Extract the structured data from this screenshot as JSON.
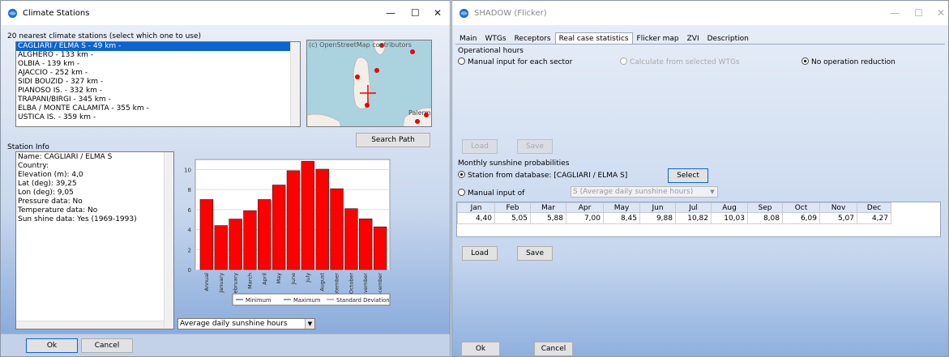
{
  "climate": {
    "title": "Climate Stations",
    "stations_header": "20 nearest climate stations (select which one to use)",
    "stations": [
      "CAGLIARI / ELMA S - 49 km -",
      "ALGHERO - 133 km -",
      "OLBIA - 139 km -",
      "AJACCIO - 252 km -",
      "SIDI BOUZID - 327 km -",
      "PIANOSO IS. - 332 km -",
      "TRAPANI/BIRGI - 345 km -",
      "ELBA / MONTE CALAMITA - 355 km -",
      "USTICA IS. - 359 km -"
    ],
    "map_attribution": "(c) OpenStreetMap contributors",
    "map_label": "Palerm",
    "search_path_label": "Search Path",
    "station_info_label": "Station Info",
    "info_lines": [
      "Name: CAGLIARI / ELMA S",
      "Country:",
      "Elevation (m): 4,0",
      "Lat (deg): 39,25",
      "Lon (deg): 9,05",
      "Pressure data: No",
      "Temperature data: No",
      "Sun shine data: Yes (1969-1993)"
    ],
    "chart_select_value": "Average daily sunshine hours",
    "ok_label": "Ok",
    "cancel_label": "Cancel"
  },
  "chart_data": {
    "type": "bar",
    "categories": [
      "Annual",
      "January",
      "February",
      "March",
      "April",
      "May",
      "June",
      "July",
      "August",
      "September",
      "October",
      "November",
      "December"
    ],
    "values": [
      7.0,
      4.4,
      5.05,
      5.88,
      7.0,
      8.45,
      9.88,
      10.82,
      10.03,
      8.08,
      6.09,
      5.07,
      4.27
    ],
    "ylim": [
      0,
      11
    ],
    "yticks": [
      "0",
      "2",
      "4",
      "6",
      "8",
      "10"
    ],
    "legend": [
      "Minimum",
      "Maximum",
      "Standard Deviation"
    ],
    "legend_colors": [
      "#1e5fc9",
      "#1a8a2a",
      "#909090"
    ],
    "bar_color": "#ff0000",
    "grid": true
  },
  "shadow": {
    "title": "SHADOW (Flicker)",
    "tabs": [
      "Main",
      "WTGs",
      "Receptors",
      "Real case statistics",
      "Flicker map",
      "ZVI",
      "Description"
    ],
    "active_tab": "Real case statistics",
    "operational_hours_label": "Operational hours",
    "op_options": [
      "Manual input for each sector",
      "Calculate from selected WTGs",
      "No operation reduction"
    ],
    "load_label": "Load",
    "save_label": "Save",
    "monthly_label": "Monthly sunshine probabilities",
    "station_option": "Station from database: [CAGLIARI / ELMA S]",
    "select_label": "Select",
    "manual_option": "Manual input of",
    "manual_combo_value": "S (Average daily sunshine hours)",
    "months": [
      "Jan",
      "Feb",
      "Mar",
      "Apr",
      "May",
      "Jun",
      "Jul",
      "Aug",
      "Sep",
      "Oct",
      "Nov",
      "Dec"
    ],
    "month_values": [
      "4,40",
      "5,05",
      "5,88",
      "7,00",
      "8,45",
      "9,88",
      "10,82",
      "10,03",
      "8,08",
      "6,09",
      "5,07",
      "4,27"
    ],
    "load2_label": "Load",
    "save2_label": "Save",
    "ok_label": "Ok",
    "cancel_label": "Cancel"
  },
  "colors": {
    "accent": "#0a64d2",
    "bar": "#ff0000"
  }
}
